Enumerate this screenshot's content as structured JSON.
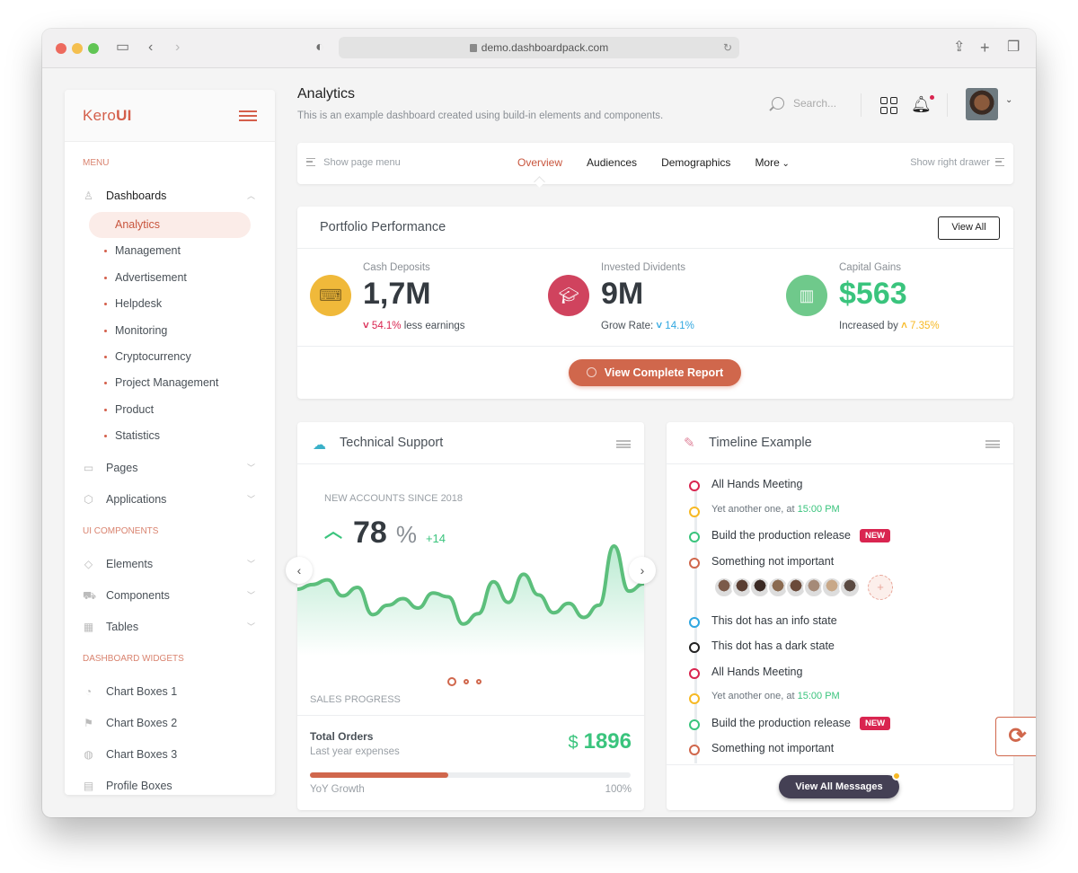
{
  "browser": {
    "url": "demo.dashboardpack.com"
  },
  "sidebar": {
    "logo_a": "Kero",
    "logo_b": "UI",
    "sections": {
      "menu": "MENU",
      "ui_components": "UI COMPONENTS",
      "dashboard_widgets": "DASHBOARD WIDGETS"
    },
    "dashboards": {
      "label": "Dashboards",
      "items": [
        "Analytics",
        "Management",
        "Advertisement",
        "Helpdesk",
        "Monitoring",
        "Cryptocurrency",
        "Project Management",
        "Product",
        "Statistics"
      ],
      "active": "Analytics"
    },
    "menu_items": [
      {
        "label": "Pages",
        "icon": "browser-icon"
      },
      {
        "label": "Applications",
        "icon": "box-icon"
      }
    ],
    "ui_items": [
      {
        "label": "Elements",
        "icon": "diamond-icon"
      },
      {
        "label": "Components",
        "icon": "car-icon"
      },
      {
        "label": "Tables",
        "icon": "table-icon"
      }
    ],
    "widget_items": [
      {
        "label": "Chart Boxes 1",
        "icon": "pie-chart-icon"
      },
      {
        "label": "Chart Boxes 2",
        "icon": "signpost-icon"
      },
      {
        "label": "Chart Boxes 3",
        "icon": "ball-icon"
      },
      {
        "label": "Profile Boxes",
        "icon": "id-card-icon"
      }
    ]
  },
  "header": {
    "title": "Analytics",
    "subtitle": "This is an example dashboard created using build-in elements and components.",
    "search_placeholder": "Search..."
  },
  "tabbar": {
    "left": "Show page menu",
    "right": "Show right drawer",
    "tabs": [
      "Overview",
      "Audiences",
      "Demographics",
      "More"
    ],
    "active": "Overview"
  },
  "portfolio": {
    "title": "Portfolio Performance",
    "view_all": "View All",
    "metrics": [
      {
        "label": "Cash Deposits",
        "value": "1,7M",
        "delta": "54.1%",
        "delta_dir": "down",
        "suffix": "less earnings",
        "prefix": "",
        "color": "#f0b93a",
        "delta_color": "#d92550"
      },
      {
        "label": "Invested Dividents",
        "value": "9M",
        "delta": "14.1%",
        "delta_dir": "down",
        "prefix": "Grow Rate:",
        "suffix": "",
        "color": "#d0435e",
        "delta_color": "#30a7e0"
      },
      {
        "label": "Capital Gains",
        "value": "$563",
        "delta": "7.35%",
        "delta_dir": "up",
        "prefix": "Increased by",
        "suffix": "",
        "color": "#6fc98b",
        "delta_color": "#f7b924"
      }
    ],
    "report_button": "View Complete Report"
  },
  "tech_support": {
    "title": "Technical Support",
    "new_accounts_label": "NEW ACCOUNTS SINCE 2018",
    "value": "78",
    "unit": "%",
    "delta": "+14",
    "sales_progress_label": "SALES PROGRESS",
    "total_orders_title": "Total Orders",
    "total_orders_sub": "Last year expenses",
    "currency": "$",
    "total_orders_value": "1896",
    "progress_fraction": 0.43,
    "yoy_label": "YoY Growth",
    "yoy_value": "100%",
    "carousel_active": 0,
    "carousel_count": 3,
    "sparkline": [
      42,
      47,
      52,
      35,
      44,
      15,
      25,
      32,
      22,
      38,
      34,
      5,
      16,
      50,
      28,
      58,
      36,
      17,
      27,
      12,
      25,
      88,
      40,
      48
    ]
  },
  "timeline": {
    "title": "Timeline Example",
    "items": [
      {
        "text": "All Hands Meeting",
        "color": "#d92550",
        "type": "normal"
      },
      {
        "text": "Yet another one, at",
        "time": "15:00 PM",
        "color": "#f7b924",
        "type": "small"
      },
      {
        "text": "Build the production release",
        "color": "#3ac47d",
        "type": "normal",
        "badge": "NEW"
      },
      {
        "text": "Something not important",
        "color": "#d0674c",
        "type": "avatars"
      },
      {
        "text": "This dot has an info state",
        "color": "#30a7e0",
        "type": "normal"
      },
      {
        "text": "This dot has a dark state",
        "color": "#222222",
        "type": "normal"
      },
      {
        "text": "All Hands Meeting",
        "color": "#d92550",
        "type": "normal"
      },
      {
        "text": "Yet another one, at",
        "time": "15:00 PM",
        "color": "#f7b924",
        "type": "small"
      },
      {
        "text": "Build the production release",
        "color": "#3ac47d",
        "type": "normal",
        "badge": "NEW"
      },
      {
        "text": "Something not important",
        "color": "#d0674c",
        "type": "normal"
      }
    ],
    "avatar_count": 8,
    "add_label": "+",
    "view_all_messages": "View All Messages"
  }
}
